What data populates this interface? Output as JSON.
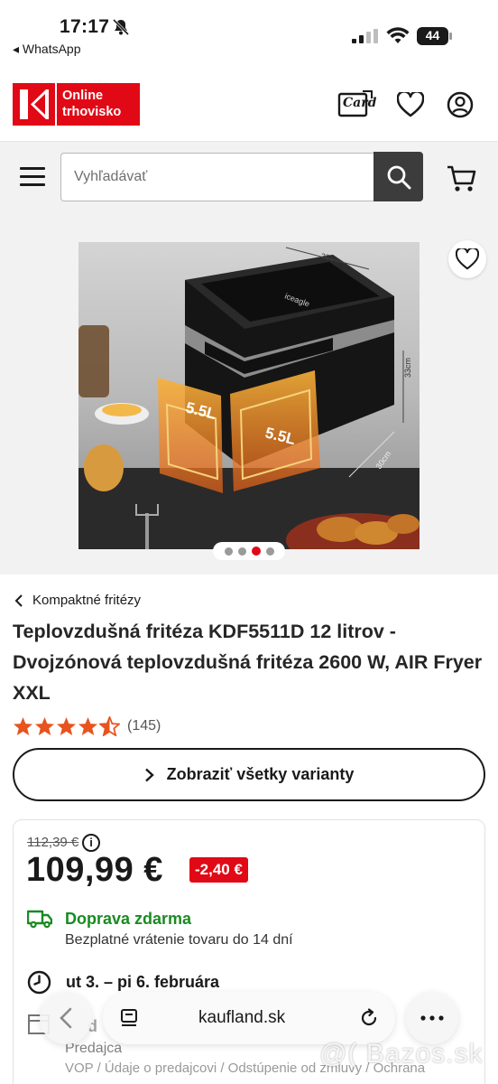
{
  "status_bar": {
    "time": "17:17",
    "back_app": "◂ WhatsApp",
    "battery": "44"
  },
  "header": {
    "logo_line1": "Online",
    "logo_line2": "trhovisko",
    "card_label": "Card",
    "icons": [
      "card-icon",
      "heart-icon",
      "user-icon"
    ]
  },
  "search": {
    "placeholder": "Vyhľadávať"
  },
  "gallery": {
    "dots_count": 4,
    "active_dot": 2,
    "image_labels": {
      "brand": "iceagle",
      "capacity_left": "5.5L",
      "capacity_right": "5.5L",
      "width": "35cm",
      "height": "33cm",
      "depth": "30cm"
    }
  },
  "product": {
    "breadcrumb": "Kompaktné fritézy",
    "title": "Teplovzdušná fritéza KDF5511D 12 litrov - Dvojzónová teplovzdušná fritéza 2600 W, AIR Fryer XXL",
    "rating": 4.5,
    "rating_count": "(145)",
    "variants_button": "Zobraziť všetky varianty"
  },
  "price": {
    "old_price": "112,39 €",
    "current_price": "109,99 €",
    "discount": "-2,40 €",
    "info": "i"
  },
  "shipping": {
    "title": "Doprava zdarma",
    "subtitle": "Bezplatné vrátenie tovaru do 14 dní",
    "delivery": "ut 3. – pi 6. februára",
    "seller_prefix": "d",
    "seller_label": "Predajca",
    "seller_sub": "VOP / Údaje o predajcovi / Odstúpenie od zmluvy / Ochrana"
  },
  "browser": {
    "url": "kaufland.sk"
  },
  "watermark": "@( Bazos.sk",
  "colors": {
    "brand_red": "#e10915",
    "shipping_green": "#1a8a22",
    "star_orange": "#e8531f"
  }
}
